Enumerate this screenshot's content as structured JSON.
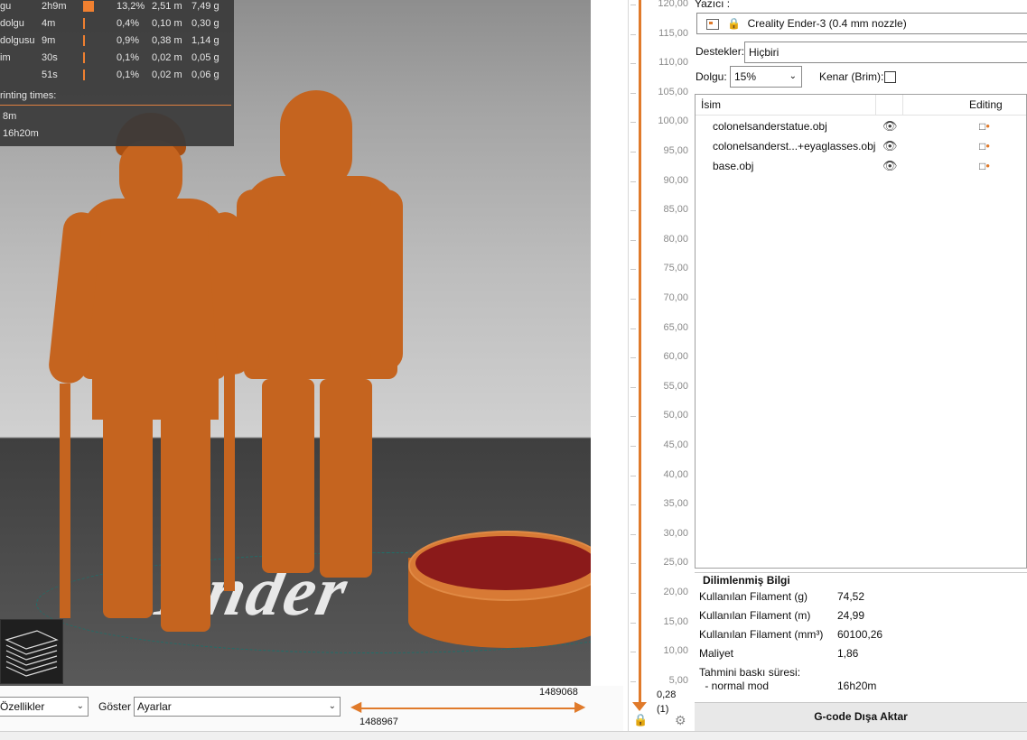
{
  "stats": {
    "rows": [
      {
        "name": "gu",
        "time": "2h9m",
        "pct": "13,2%",
        "len": "2,51 m",
        "weight": "7,49 g",
        "bar": 0.132
      },
      {
        "name": "dolgu",
        "time": "4m",
        "pct": "0,4%",
        "len": "0,10 m",
        "weight": "0,30 g",
        "bar": 0.004
      },
      {
        "name": "dolgusu",
        "time": "9m",
        "pct": "0,9%",
        "len": "0,38 m",
        "weight": "1,14 g",
        "bar": 0.009
      },
      {
        "name": "im",
        "time": "30s",
        "pct": "0,1%",
        "len": "0,02 m",
        "weight": "0,05 g",
        "bar": 0.001
      },
      {
        "name": "",
        "time": "51s",
        "pct": "0,1%",
        "len": "0,02 m",
        "weight": "0,06 g",
        "bar": 0.001
      }
    ],
    "printing_times_label": "rinting times:",
    "print_times": [
      "8m",
      "16h20m"
    ]
  },
  "bottombar": {
    "view_select": "Özellikler",
    "show_label": "Göster",
    "show_select": "Ayarlar",
    "range_top": "1489068",
    "range_bottom": "1488967"
  },
  "slider": {
    "ticks": [
      "120,00",
      "115,00",
      "110,00",
      "105,00",
      "100,00",
      "95,00",
      "90,00",
      "85,00",
      "80,00",
      "75,00",
      "70,00",
      "65,00",
      "60,00",
      "55,00",
      "50,00",
      "45,00",
      "40,00",
      "35,00",
      "30,00",
      "25,00",
      "20,00",
      "15,00",
      "10,00",
      "5,00"
    ],
    "current_height": "0,28",
    "current_layer": "(1)"
  },
  "panel": {
    "printer_label": "Yazıcı :",
    "printer_value": "Creality Ender-3 (0.4 mm nozzle)",
    "supports_label": "Destekler:",
    "supports_value": "Hiçbiri",
    "infill_label": "Dolgu:",
    "infill_value": "15%",
    "brim_label": "Kenar (Brim):",
    "objects_header_name": "İsim",
    "objects_header_editing": "Editing",
    "objects": [
      "colonelsanderstatue.obj",
      "colonelsanderst...+eyaglasses.obj",
      "base.obj"
    ],
    "sliced_info_title": "Dilimlenmiş Bilgi",
    "info_rows": [
      {
        "label": "Kullanılan Filament (g)",
        "value": "74,52"
      },
      {
        "label": "Kullanılan Filament (m)",
        "value": "24,99"
      },
      {
        "label": "Kullanılan Filament (mm³)",
        "value": "60100,26"
      },
      {
        "label": "Maliyet",
        "value": "1,86"
      }
    ],
    "print_time_label": "Tahmini baskı süresi:",
    "mode_label": " - normal mod",
    "mode_value": "16h20m",
    "export_button": "G-code Dışa Aktar"
  },
  "colors": {
    "accent": "#e07a2a",
    "model_orange": "#c5641f",
    "base_red": "#8b1a1a"
  }
}
